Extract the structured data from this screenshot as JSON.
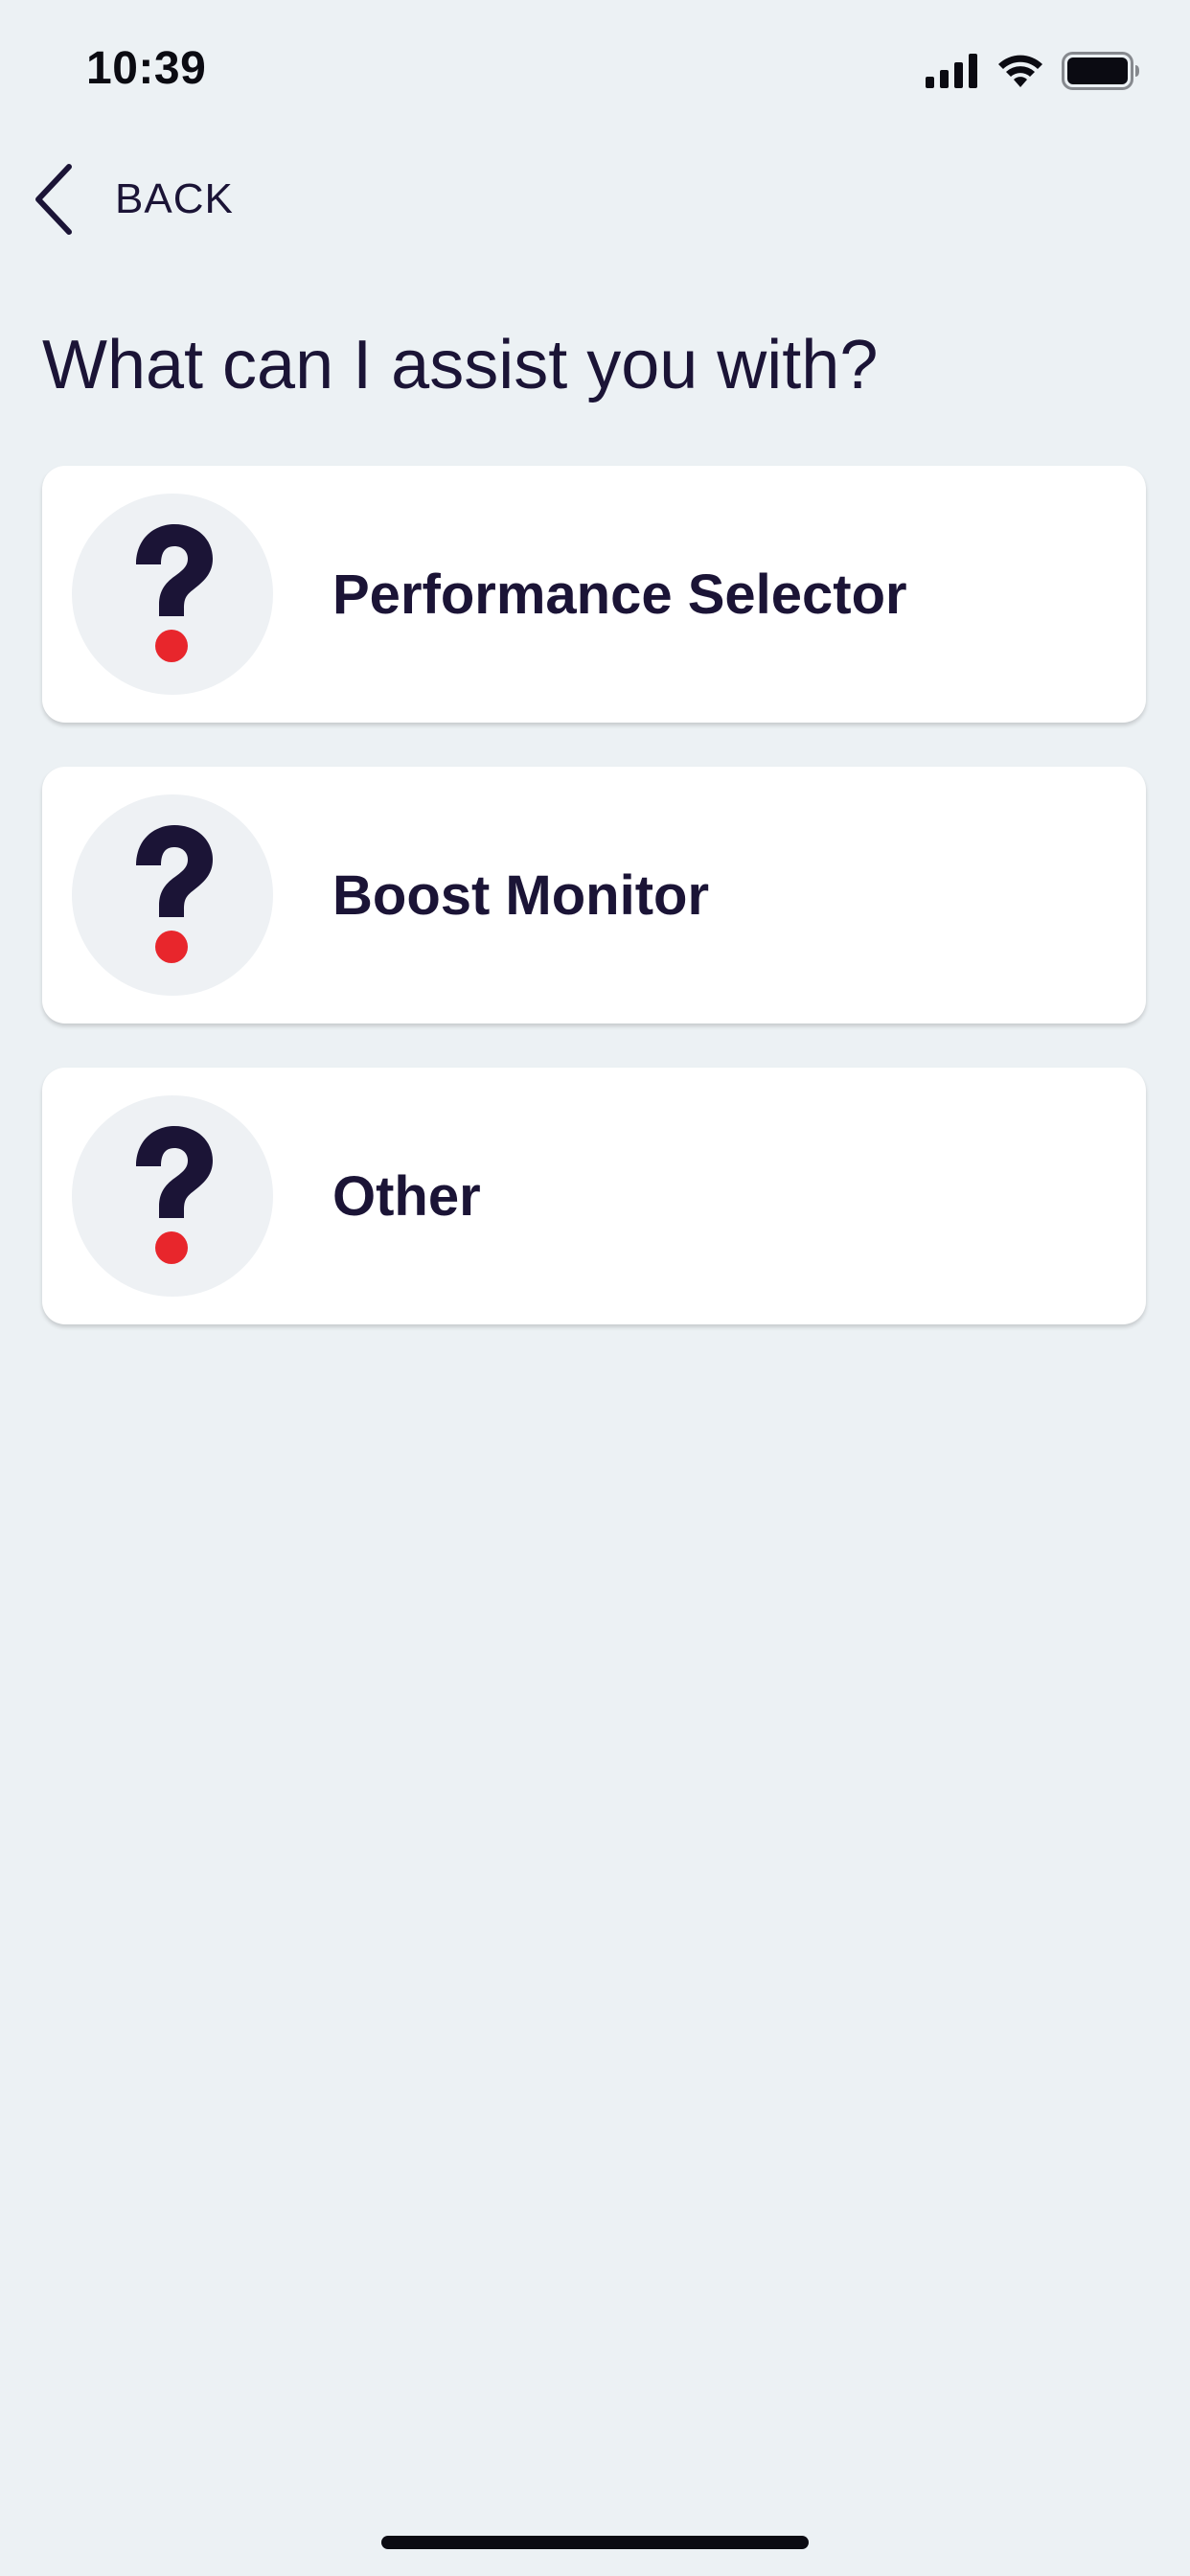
{
  "status_bar": {
    "time": "10:39",
    "icons": [
      "cellular-signal-icon",
      "wifi-icon",
      "battery-icon"
    ]
  },
  "nav": {
    "back_label": "BACK",
    "back_icon": "chevron-left-icon"
  },
  "page": {
    "title": "What can I assist you with?"
  },
  "options": [
    {
      "label": "Performance Selector",
      "icon": "question-mark-icon"
    },
    {
      "label": "Boost Monitor",
      "icon": "question-mark-icon"
    },
    {
      "label": "Other",
      "icon": "question-mark-icon"
    }
  ],
  "colors": {
    "background": "#ecf1f4",
    "card": "#ffffff",
    "text_primary": "#1b1436",
    "accent_red": "#e8262c",
    "icon_circle": "#eef1f4"
  }
}
